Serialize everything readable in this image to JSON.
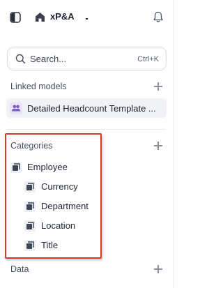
{
  "header": {
    "workspace_name": "xP&A",
    "toggle_icon": "sidebar-toggle-icon",
    "home_icon": "home-icon",
    "bell_icon": "bell-icon"
  },
  "search": {
    "placeholder": "Search...",
    "shortcut": "Ctrl+K"
  },
  "linked_models": {
    "heading": "Linked models",
    "items": [
      {
        "label": "Detailed Headcount Template ...",
        "icon": "users-icon"
      }
    ]
  },
  "categories": {
    "heading": "Categories",
    "items": [
      {
        "label": "Employee",
        "level": 0
      },
      {
        "label": "Currency",
        "level": 1
      },
      {
        "label": "Department",
        "level": 1
      },
      {
        "label": "Location",
        "level": 1
      },
      {
        "label": "Title",
        "level": 1
      }
    ]
  },
  "data_section": {
    "heading": "Data"
  },
  "colors": {
    "highlight": "#d23a2a",
    "model_icon": "#7b5cc4",
    "cube_icon": "#3f4656"
  }
}
